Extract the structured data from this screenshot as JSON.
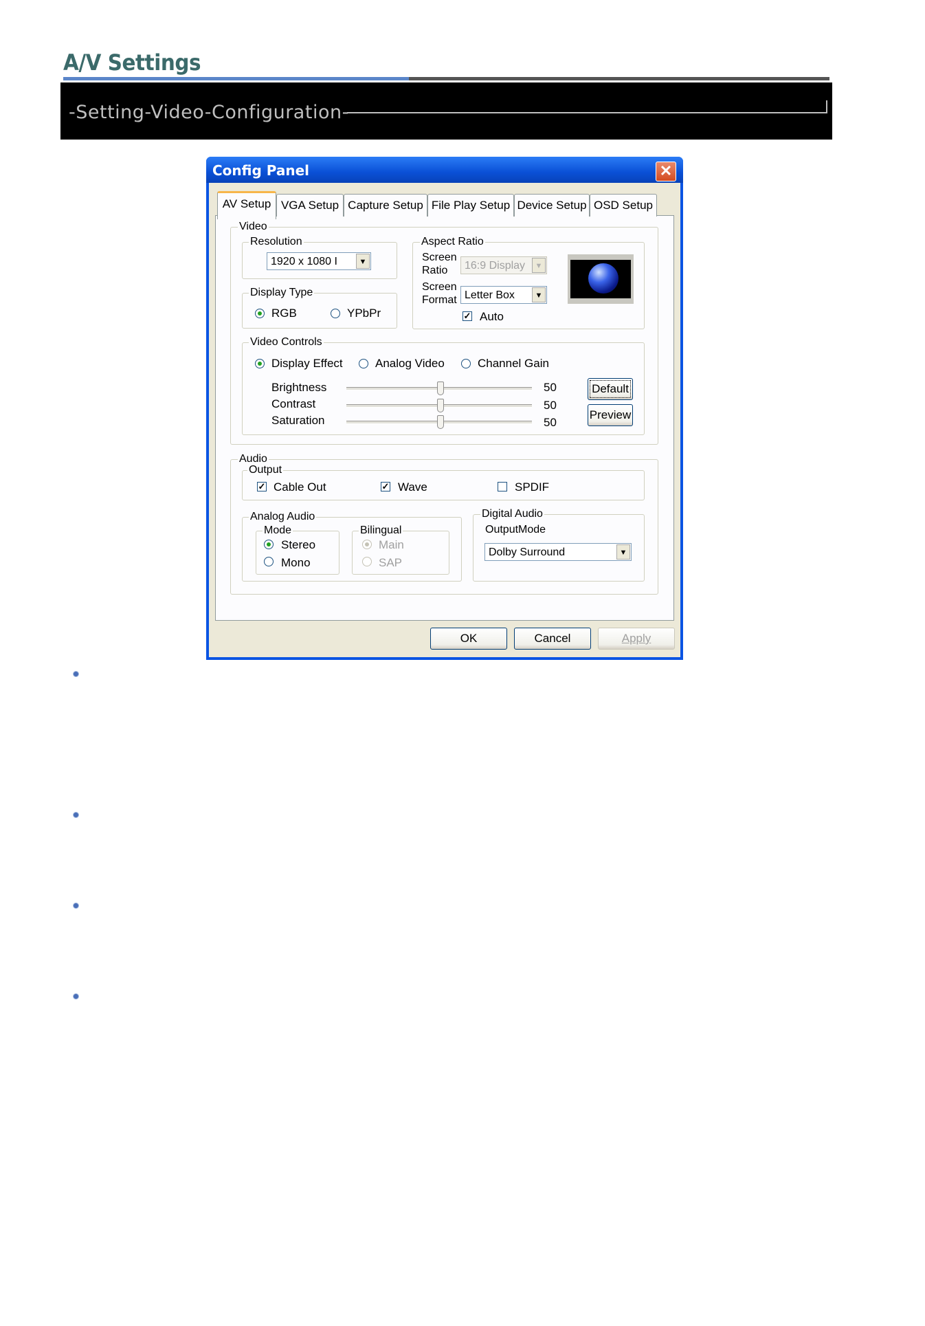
{
  "page": {
    "title": "A/V Settings",
    "banner": "-Setting-Video-Configuration-"
  },
  "dialog": {
    "title": "Config Panel",
    "tabs": [
      {
        "label": "AV Setup"
      },
      {
        "label": "VGA Setup"
      },
      {
        "label": "Capture Setup"
      },
      {
        "label": "File Play Setup"
      },
      {
        "label": "Device Setup"
      },
      {
        "label": "OSD Setup"
      }
    ],
    "video": {
      "label": "Video",
      "resolution": {
        "label": "Resolution",
        "value": "1920 x 1080 I"
      },
      "display_type": {
        "label": "Display Type",
        "options": [
          "RGB",
          "YPbPr"
        ],
        "selected": "RGB"
      },
      "aspect_ratio": {
        "label": "Aspect Ratio",
        "screen_ratio_label_1": "Screen",
        "screen_ratio_label_2": "Ratio",
        "screen_ratio_value": "16:9 Display",
        "screen_format_label_1": "Screen",
        "screen_format_label_2": "Format",
        "screen_format_value": "Letter Box",
        "auto_label": "Auto",
        "auto_checked": true
      },
      "controls": {
        "label": "Video Controls",
        "modes": [
          "Display Effect",
          "Analog Video",
          "Channel Gain"
        ],
        "selected_mode": "Display Effect",
        "sliders": [
          {
            "label": "Brightness",
            "value": "50"
          },
          {
            "label": "Contrast",
            "value": "50"
          },
          {
            "label": "Saturation",
            "value": "50"
          }
        ],
        "default_button": "Default",
        "preview_button": "Preview"
      }
    },
    "audio": {
      "label": "Audio",
      "output": {
        "label": "Output",
        "cable_out": {
          "label": "Cable Out",
          "checked": true
        },
        "wave": {
          "label": "Wave",
          "checked": true
        },
        "spdif": {
          "label": "SPDIF",
          "checked": false
        }
      },
      "analog": {
        "label": "Analog Audio",
        "mode_label": "Mode",
        "stereo": "Stereo",
        "mono": "Mono",
        "bilingual_label": "Bilingual",
        "main": "Main",
        "sap": "SAP"
      },
      "digital": {
        "label": "Digital Audio",
        "output_mode_label": "OutputMode",
        "output_mode_value": "Dolby Surround"
      }
    },
    "buttons": {
      "ok": "OK",
      "cancel": "Cancel",
      "apply": "Apply"
    }
  },
  "colors": {
    "title_accent": "#3b6a6a",
    "banner_bg": "#000000",
    "titlebar": "#0a54e3"
  }
}
